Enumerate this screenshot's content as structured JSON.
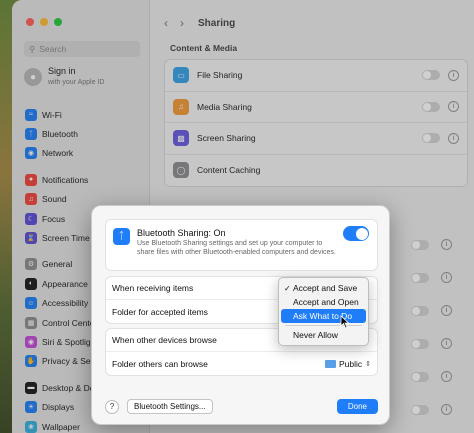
{
  "sidebar": {
    "search_placeholder": "Search",
    "account": {
      "line1": "Sign in",
      "line2": "with your Apple ID"
    },
    "items": [
      {
        "label": "Wi-Fi",
        "icon": "wifi-icon",
        "color": "#1f7ef7"
      },
      {
        "label": "Bluetooth",
        "icon": "bluetooth-icon",
        "color": "#1f7ef7"
      },
      {
        "label": "Network",
        "icon": "globe-icon",
        "color": "#1f7ef7"
      },
      {
        "label": "Notifications",
        "icon": "bell-icon",
        "color": "#f2453d"
      },
      {
        "label": "Sound",
        "icon": "speaker-icon",
        "color": "#f2453d"
      },
      {
        "label": "Focus",
        "icon": "moon-icon",
        "color": "#5b4fd6"
      },
      {
        "label": "Screen Time",
        "icon": "hourglass-icon",
        "color": "#5b4fd6"
      },
      {
        "label": "General",
        "icon": "gear-icon",
        "color": "#8e8e93"
      },
      {
        "label": "Appearance",
        "icon": "appearance-icon",
        "color": "#1c1c1e"
      },
      {
        "label": "Accessibility",
        "icon": "accessibility-icon",
        "color": "#1f7ef7"
      },
      {
        "label": "Control Center",
        "icon": "control-center-icon",
        "color": "#8e8e93"
      },
      {
        "label": "Siri & Spotlight",
        "icon": "siri-icon",
        "color": "#c24bd6"
      },
      {
        "label": "Privacy & Security",
        "icon": "hand-icon",
        "color": "#1f7ef7"
      },
      {
        "label": "Desktop & Dock",
        "icon": "dock-icon",
        "color": "#1c1c1e"
      },
      {
        "label": "Displays",
        "icon": "display-icon",
        "color": "#1f7ef7"
      },
      {
        "label": "Wallpaper",
        "icon": "wallpaper-icon",
        "color": "#38b0de"
      }
    ]
  },
  "main": {
    "title": "Sharing",
    "section": "Content & Media",
    "rows": [
      {
        "label": "File Sharing",
        "icon": "folder-icon",
        "color": "#38a3e8"
      },
      {
        "label": "Media Sharing",
        "icon": "music-icon",
        "color": "#f29a38"
      },
      {
        "label": "Screen Sharing",
        "icon": "screen-sharing-icon",
        "color": "#6a5be0"
      },
      {
        "label": "Content Caching",
        "icon": "cache-icon",
        "color": "#8e8e93"
      }
    ]
  },
  "dialog": {
    "title": "Bluetooth Sharing: On",
    "description": "Use Bluetooth Sharing settings and set up your computer to share files with other Bluetooth-enabled computers and devices.",
    "receiving_label": "When receiving items",
    "folder_label": "Folder for accepted items",
    "browse_label": "When other devices browse",
    "browse_folder_label": "Folder others can browse",
    "browse_folder_value": "Public",
    "help": "?",
    "settings_button": "Bluetooth Settings...",
    "done_button": "Done"
  },
  "menu": {
    "items": [
      "Accept and Save",
      "Accept and Open",
      "Ask What to Do",
      "Never Allow"
    ]
  },
  "colors": {
    "accent": "#1f7ef7"
  }
}
